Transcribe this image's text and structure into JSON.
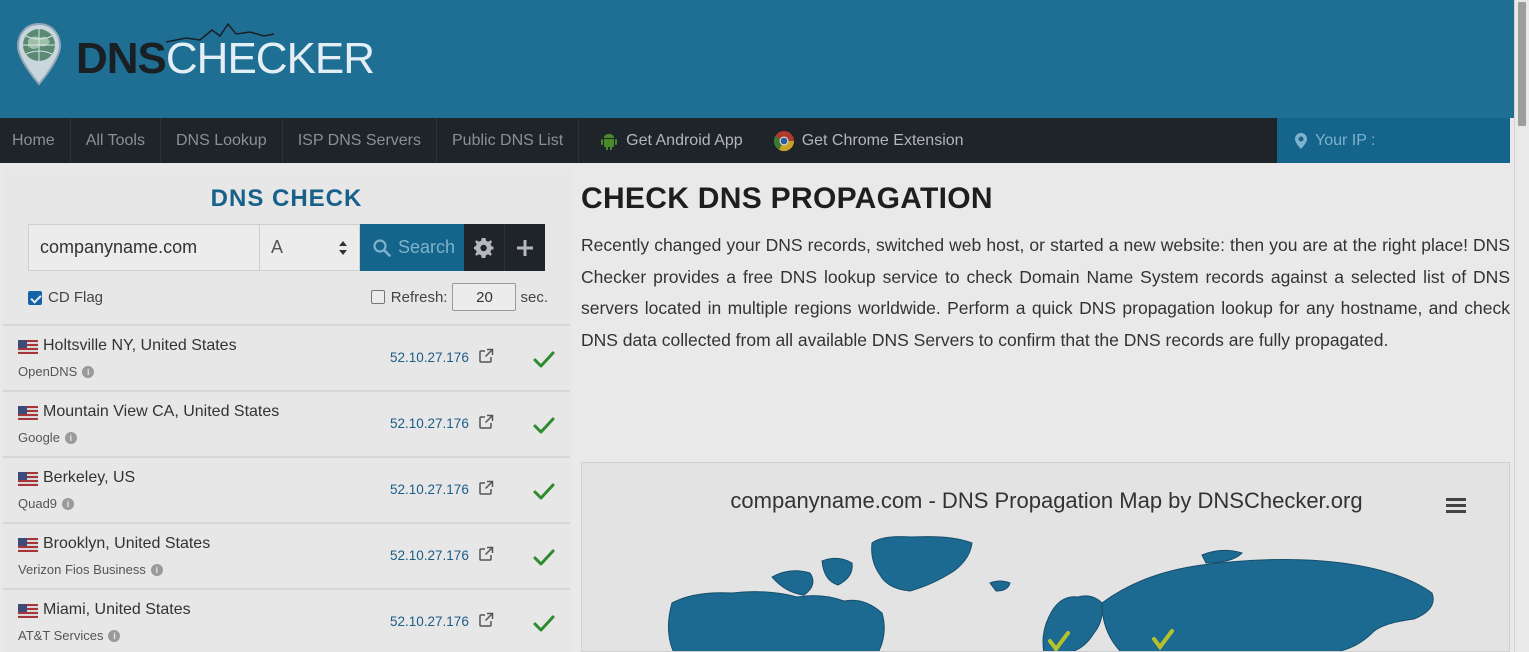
{
  "header": {
    "logo_dns": "DNS",
    "logo_checker": "CHECKER"
  },
  "nav": {
    "items": [
      "Home",
      "All Tools",
      "DNS Lookup",
      "ISP DNS Servers",
      "Public DNS List"
    ],
    "android": "Get Android App",
    "chrome": "Get Chrome Extension",
    "your_ip": "Your IP :"
  },
  "dns_check": {
    "title": "DNS CHECK",
    "domain_value": "companyname.com",
    "record_type": "A",
    "search_label": "Search",
    "cd_flag_label": "CD Flag",
    "cd_flag_checked": true,
    "refresh_label": "Refresh:",
    "refresh_checked": false,
    "refresh_value": "20",
    "refresh_unit": "sec."
  },
  "servers": [
    {
      "location": "Holtsville NY, United States",
      "provider": "OpenDNS",
      "ip": "52.10.27.176",
      "status": "ok"
    },
    {
      "location": "Mountain View CA, United States",
      "provider": "Google",
      "ip": "52.10.27.176",
      "status": "ok"
    },
    {
      "location": "Berkeley, US",
      "provider": "Quad9",
      "ip": "52.10.27.176",
      "status": "ok"
    },
    {
      "location": "Brooklyn, United States",
      "provider": "Verizon Fios Business",
      "ip": "52.10.27.176",
      "status": "ok"
    },
    {
      "location": "Miami, United States",
      "provider": "AT&T Services",
      "ip": "52.10.27.176",
      "status": "ok"
    }
  ],
  "main": {
    "title": "CHECK DNS PROPAGATION",
    "description": "Recently changed your DNS records, switched web host, or started a new website: then you are at the right place! DNS Checker provides a free DNS lookup service to check Domain Name System records against a selected list of DNS servers located in multiple regions worldwide. Perform a quick DNS propagation lookup for any hostname, and check DNS data collected from all available DNS Servers to confirm that the DNS records are fully propagated."
  },
  "map": {
    "title": "companyname.com - DNS Propagation Map by DNSChecker.org"
  },
  "colors": {
    "header_bg": "#1f6f94",
    "nav_bg": "#1e2429",
    "accent": "#14648b",
    "check_green": "#2e8b2e"
  }
}
